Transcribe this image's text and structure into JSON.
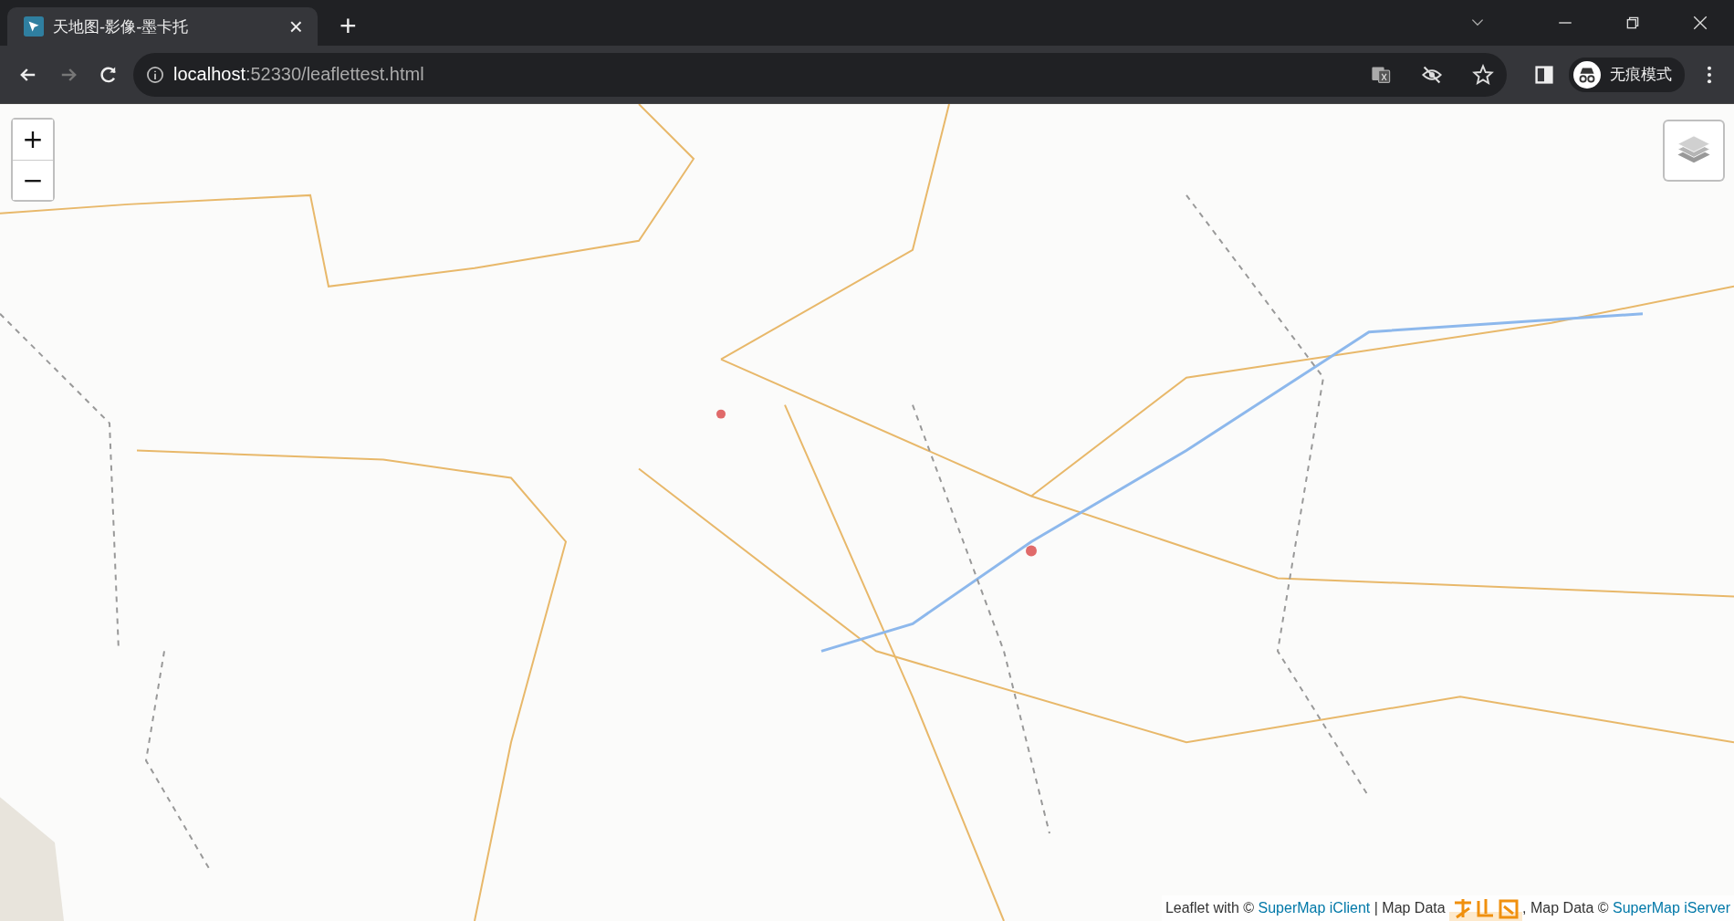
{
  "tab": {
    "title": "天地图-影像-墨卡托",
    "close": "×",
    "selected": true
  },
  "new_tab": "+",
  "address_bar": {
    "host": "localhost",
    "rest": ":52330/leaflettest.html"
  },
  "profile": {
    "label": "无痕模式"
  },
  "map": {
    "kind": "picture",
    "zoom_controls": [
      "+",
      "−"
    ],
    "attribution": [
      {
        "kind": "text",
        "text": "Leaflet with © "
      },
      {
        "kind": "link",
        "text": "SuperMap iClient"
      },
      {
        "kind": "text",
        "text": " | Map Data "
      },
      {
        "kind": "logo"
      },
      {
        "kind": "text",
        "text": ", Map Data © "
      },
      {
        "kind": "link",
        "text": "SuperMap iServer"
      }
    ]
  }
}
